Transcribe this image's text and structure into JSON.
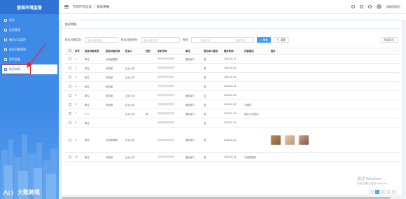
{
  "app": {
    "title": "营商环境监督",
    "brand_watermark": "大数跨境"
  },
  "sidebar": {
    "items": [
      {
        "label": "首页",
        "icon": "home-icon",
        "active": false
      },
      {
        "label": "信息管理",
        "icon": "info-icon",
        "active": false
      },
      {
        "label": "服务对话监控",
        "icon": "chat-icon",
        "active": false
      },
      {
        "label": "投诉问题管理",
        "icon": "complaint-icon",
        "active": false
      },
      {
        "label": "案件监督",
        "icon": "case-icon",
        "active": false
      },
      {
        "label": "投诉举报",
        "icon": "report-icon",
        "active": true
      }
    ]
  },
  "header": {
    "breadcrumb": [
      "营商环境监督",
      "投诉举报"
    ],
    "separator": "/",
    "user": "超级管理员"
  },
  "panel": {
    "title": "投诉举报"
  },
  "filters": {
    "type_label": "投诉对象类型:",
    "type_placeholder": "投诉对象类型",
    "name_label": "投诉对象名称:",
    "name_placeholder": "投诉对象名称",
    "time_label": "时间:",
    "start_placeholder": "开始时间",
    "to": "-",
    "end_placeholder": "结束时间",
    "search_label": "搜索",
    "reset_label": "重置",
    "export_label": "批量导出"
  },
  "table": {
    "columns": [
      "序号",
      "投诉对象类型",
      "投诉对象名称",
      "投诉人",
      "性别",
      "手机号码",
      "单位",
      "是否本人服务",
      "服务时间",
      "内容描述",
      "图片"
    ],
    "rows": [
      {
        "no": "1",
        "type": "单位",
        "name": "业务管理局",
        "person": "",
        "sex": "",
        "phone": "",
        "unit": "服务部门",
        "self": "是",
        "time": "2022-04-21",
        "desc": "",
        "images": false
      },
      {
        "no": "2",
        "type": "单位",
        "name": "环境局",
        "person": "企业人员",
        "sex": "",
        "phone": "",
        "unit": "",
        "self": "是",
        "time": "2022-04-19",
        "desc": "",
        "images": false
      },
      {
        "no": "3",
        "type": "单位",
        "name": "环境局",
        "person": "企业人员",
        "sex": "",
        "phone": "",
        "unit": "",
        "self": "是",
        "time": "2007-04-19",
        "desc": "",
        "images": false
      },
      {
        "no": "4",
        "type": "单位",
        "name": "税务局",
        "person": "",
        "sex": "",
        "phone": "",
        "unit": "",
        "self": "是",
        "time": "2022-04-15",
        "desc": "",
        "images": false
      },
      {
        "no": "5",
        "type": "单位",
        "name": "税务局",
        "person": "企业人员",
        "sex": "",
        "phone": "",
        "unit": "服务部门",
        "self": "否",
        "time": "2022-04-15",
        "desc": "",
        "images": false
      },
      {
        "no": "6",
        "type": "单位",
        "name": "测试局",
        "person": "企业人员",
        "sex": "",
        "phone": "",
        "unit": "服务部门",
        "self": "是",
        "time": "2022-04-15",
        "desc": "不满意",
        "images": false
      },
      {
        "no": "7",
        "type": "个人",
        "name": "",
        "person": "企业人员",
        "sex": "男",
        "phone": "",
        "unit": "服务部门",
        "self": "是",
        "time": "2022-04-15",
        "desc": "单位人员投诉",
        "images": false
      },
      {
        "no": "8",
        "type": "单位",
        "name": "",
        "person": "",
        "sex": "",
        "phone": "",
        "unit": "",
        "self": "否",
        "time": "2022-04-15",
        "desc": "",
        "images": false
      },
      {
        "no": "9",
        "type": "单位",
        "name": "业务管理局",
        "person": "企业人员",
        "sex": "",
        "phone": "",
        "unit": "服务部门",
        "self": "是",
        "time": "2022-04-15",
        "desc": "",
        "images": true
      },
      {
        "no": "10",
        "type": "单位",
        "name": "环境局",
        "person": "企业人员",
        "sex": "",
        "phone": "",
        "unit": "服务部门",
        "self": "是",
        "time": "2022-04-14",
        "desc": "不满意服务",
        "images": false
      }
    ]
  },
  "windows_watermark": {
    "line1": "激活 Windows",
    "line2": "转到\"设置\"以激活 Windows。"
  },
  "pager": {
    "pages": [
      "<",
      "1",
      "2",
      "3",
      ">"
    ],
    "active": "1"
  }
}
